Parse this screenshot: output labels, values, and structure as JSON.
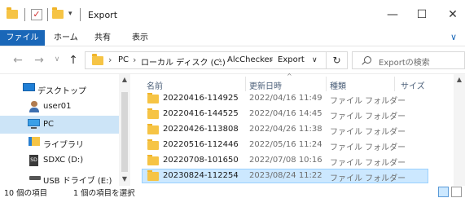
{
  "window": {
    "title": "Export",
    "minimize_glyph": "—",
    "maximize_glyph": "☐",
    "close_glyph": "✕",
    "quick_access_arrow": "▾"
  },
  "ribbon": {
    "tabs": [
      "ファイル",
      "ホーム",
      "共有",
      "表示"
    ],
    "active_tab_color": "#1a67b8",
    "expand_glyph": "∨"
  },
  "address": {
    "back_glyph": "←",
    "forward_glyph": "→",
    "recent_glyph": "∨",
    "up_glyph": "↑",
    "crumbs": [
      "PC",
      "ローカル ディスク (C:)",
      "AlcChecker",
      "Export"
    ],
    "separator": "›",
    "dropdown_glyph": "∨",
    "refresh_glyph": "↻"
  },
  "search": {
    "placeholder": "Exportの検索"
  },
  "nav": {
    "items": [
      {
        "label": "デスクトップ",
        "icon": "desktop-icon",
        "selected": false
      },
      {
        "label": "user01",
        "icon": "user-icon",
        "selected": false
      },
      {
        "label": "PC",
        "icon": "pc-icon",
        "selected": true
      },
      {
        "label": "ライブラリ",
        "icon": "library-icon",
        "selected": false
      },
      {
        "label": "SDXC (D:)",
        "icon": "sd-card-icon",
        "selected": false
      },
      {
        "label": "USB ドライブ (E:)",
        "icon": "usb-drive-icon",
        "selected": false
      }
    ]
  },
  "columns": {
    "name": "名前",
    "date": "更新日時",
    "type": "種類",
    "size": "サイズ"
  },
  "files": [
    {
      "name": "20220416-114925",
      "date": "2022/04/16 11:49",
      "type": "ファイル フォルダー",
      "selected": false
    },
    {
      "name": "20220416-144525",
      "date": "2022/04/16 14:45",
      "type": "ファイル フォルダー",
      "selected": false
    },
    {
      "name": "20220426-113808",
      "date": "2022/04/26 11:38",
      "type": "ファイル フォルダー",
      "selected": false
    },
    {
      "name": "20220516-112446",
      "date": "2022/05/16 11:24",
      "type": "ファイル フォルダー",
      "selected": false
    },
    {
      "name": "20220708-101650",
      "date": "2022/07/08 10:16",
      "type": "ファイル フォルダー",
      "selected": false
    },
    {
      "name": "20230824-112254",
      "date": "2023/08/24 11:22",
      "type": "ファイル フォルダー",
      "selected": true
    }
  ],
  "status": {
    "item_count": "10 個の項目",
    "selected_count": "1 個の項目を選択"
  },
  "colors": {
    "selection": "#cce8ff",
    "selection_border": "#99d1ff",
    "nav_selection": "#cce4f7",
    "folder": "#f6c445"
  }
}
